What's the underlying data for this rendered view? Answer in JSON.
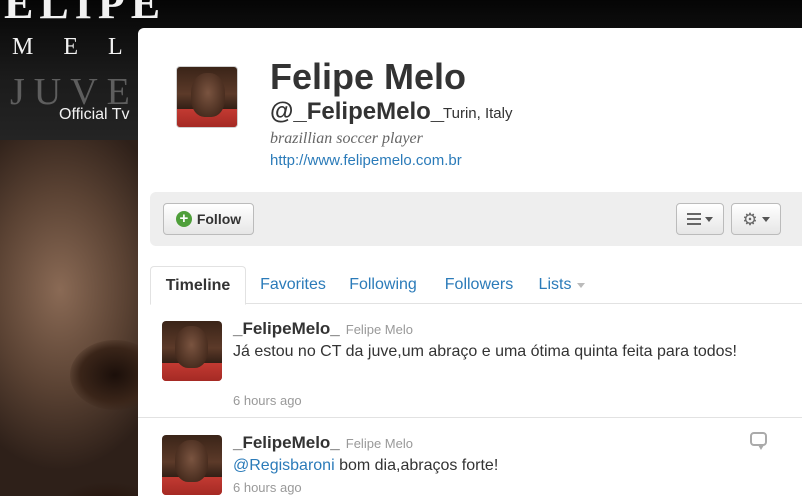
{
  "background": {
    "line1": "ELIPE",
    "line2": "MELO",
    "line3": "JUVENT",
    "line4": "Official Tv"
  },
  "profile": {
    "name": "Felipe Melo",
    "handle": "@_FelipeMelo_",
    "location": "Turin, Italy",
    "bio": "brazillian soccer player",
    "url": "http://www.felipemelo.com.br"
  },
  "actions": {
    "follow_label": "Follow",
    "list_icon": "list-icon",
    "settings_icon": "gear-icon"
  },
  "tabs": [
    {
      "label": "Timeline",
      "active": true
    },
    {
      "label": "Favorites"
    },
    {
      "label": "Following"
    },
    {
      "label": "Followers"
    },
    {
      "label": "Lists"
    }
  ],
  "tweets": [
    {
      "user": "_FelipeMelo_",
      "fullname": "Felipe Melo",
      "text": "Já estou no CT da juve,um abraço e uma ótima quinta feita para todos!",
      "time": "6 hours ago"
    },
    {
      "user": "_FelipeMelo_",
      "fullname": "Felipe Melo",
      "mention": "@Regisbaroni",
      "text": " bom dia,abraços forte!",
      "time": "6 hours ago"
    }
  ],
  "colors": {
    "link": "#2b7bb9",
    "text": "#333333",
    "muted": "#999999",
    "follow_green": "#4f9f3a"
  }
}
